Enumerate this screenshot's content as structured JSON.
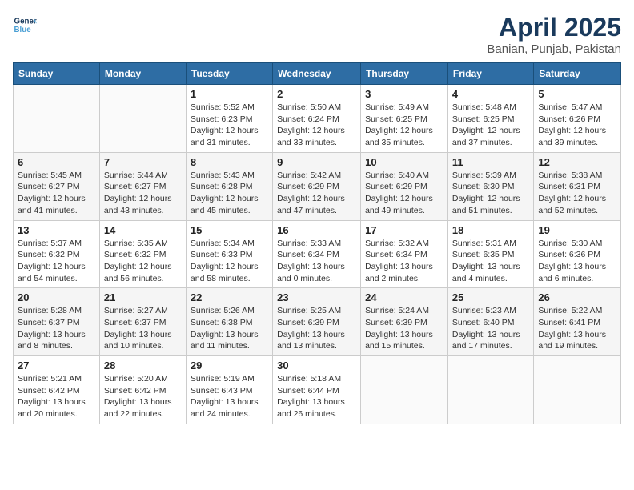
{
  "header": {
    "logo_line1": "General",
    "logo_line2": "Blue",
    "month_title": "April 2025",
    "location": "Banian, Punjab, Pakistan"
  },
  "weekdays": [
    "Sunday",
    "Monday",
    "Tuesday",
    "Wednesday",
    "Thursday",
    "Friday",
    "Saturday"
  ],
  "weeks": [
    [
      {
        "day": "",
        "info": ""
      },
      {
        "day": "",
        "info": ""
      },
      {
        "day": "1",
        "info": "Sunrise: 5:52 AM\nSunset: 6:23 PM\nDaylight: 12 hours\nand 31 minutes."
      },
      {
        "day": "2",
        "info": "Sunrise: 5:50 AM\nSunset: 6:24 PM\nDaylight: 12 hours\nand 33 minutes."
      },
      {
        "day": "3",
        "info": "Sunrise: 5:49 AM\nSunset: 6:25 PM\nDaylight: 12 hours\nand 35 minutes."
      },
      {
        "day": "4",
        "info": "Sunrise: 5:48 AM\nSunset: 6:25 PM\nDaylight: 12 hours\nand 37 minutes."
      },
      {
        "day": "5",
        "info": "Sunrise: 5:47 AM\nSunset: 6:26 PM\nDaylight: 12 hours\nand 39 minutes."
      }
    ],
    [
      {
        "day": "6",
        "info": "Sunrise: 5:45 AM\nSunset: 6:27 PM\nDaylight: 12 hours\nand 41 minutes."
      },
      {
        "day": "7",
        "info": "Sunrise: 5:44 AM\nSunset: 6:27 PM\nDaylight: 12 hours\nand 43 minutes."
      },
      {
        "day": "8",
        "info": "Sunrise: 5:43 AM\nSunset: 6:28 PM\nDaylight: 12 hours\nand 45 minutes."
      },
      {
        "day": "9",
        "info": "Sunrise: 5:42 AM\nSunset: 6:29 PM\nDaylight: 12 hours\nand 47 minutes."
      },
      {
        "day": "10",
        "info": "Sunrise: 5:40 AM\nSunset: 6:29 PM\nDaylight: 12 hours\nand 49 minutes."
      },
      {
        "day": "11",
        "info": "Sunrise: 5:39 AM\nSunset: 6:30 PM\nDaylight: 12 hours\nand 51 minutes."
      },
      {
        "day": "12",
        "info": "Sunrise: 5:38 AM\nSunset: 6:31 PM\nDaylight: 12 hours\nand 52 minutes."
      }
    ],
    [
      {
        "day": "13",
        "info": "Sunrise: 5:37 AM\nSunset: 6:32 PM\nDaylight: 12 hours\nand 54 minutes."
      },
      {
        "day": "14",
        "info": "Sunrise: 5:35 AM\nSunset: 6:32 PM\nDaylight: 12 hours\nand 56 minutes."
      },
      {
        "day": "15",
        "info": "Sunrise: 5:34 AM\nSunset: 6:33 PM\nDaylight: 12 hours\nand 58 minutes."
      },
      {
        "day": "16",
        "info": "Sunrise: 5:33 AM\nSunset: 6:34 PM\nDaylight: 13 hours\nand 0 minutes."
      },
      {
        "day": "17",
        "info": "Sunrise: 5:32 AM\nSunset: 6:34 PM\nDaylight: 13 hours\nand 2 minutes."
      },
      {
        "day": "18",
        "info": "Sunrise: 5:31 AM\nSunset: 6:35 PM\nDaylight: 13 hours\nand 4 minutes."
      },
      {
        "day": "19",
        "info": "Sunrise: 5:30 AM\nSunset: 6:36 PM\nDaylight: 13 hours\nand 6 minutes."
      }
    ],
    [
      {
        "day": "20",
        "info": "Sunrise: 5:28 AM\nSunset: 6:37 PM\nDaylight: 13 hours\nand 8 minutes."
      },
      {
        "day": "21",
        "info": "Sunrise: 5:27 AM\nSunset: 6:37 PM\nDaylight: 13 hours\nand 10 minutes."
      },
      {
        "day": "22",
        "info": "Sunrise: 5:26 AM\nSunset: 6:38 PM\nDaylight: 13 hours\nand 11 minutes."
      },
      {
        "day": "23",
        "info": "Sunrise: 5:25 AM\nSunset: 6:39 PM\nDaylight: 13 hours\nand 13 minutes."
      },
      {
        "day": "24",
        "info": "Sunrise: 5:24 AM\nSunset: 6:39 PM\nDaylight: 13 hours\nand 15 minutes."
      },
      {
        "day": "25",
        "info": "Sunrise: 5:23 AM\nSunset: 6:40 PM\nDaylight: 13 hours\nand 17 minutes."
      },
      {
        "day": "26",
        "info": "Sunrise: 5:22 AM\nSunset: 6:41 PM\nDaylight: 13 hours\nand 19 minutes."
      }
    ],
    [
      {
        "day": "27",
        "info": "Sunrise: 5:21 AM\nSunset: 6:42 PM\nDaylight: 13 hours\nand 20 minutes."
      },
      {
        "day": "28",
        "info": "Sunrise: 5:20 AM\nSunset: 6:42 PM\nDaylight: 13 hours\nand 22 minutes."
      },
      {
        "day": "29",
        "info": "Sunrise: 5:19 AM\nSunset: 6:43 PM\nDaylight: 13 hours\nand 24 minutes."
      },
      {
        "day": "30",
        "info": "Sunrise: 5:18 AM\nSunset: 6:44 PM\nDaylight: 13 hours\nand 26 minutes."
      },
      {
        "day": "",
        "info": ""
      },
      {
        "day": "",
        "info": ""
      },
      {
        "day": "",
        "info": ""
      }
    ]
  ]
}
